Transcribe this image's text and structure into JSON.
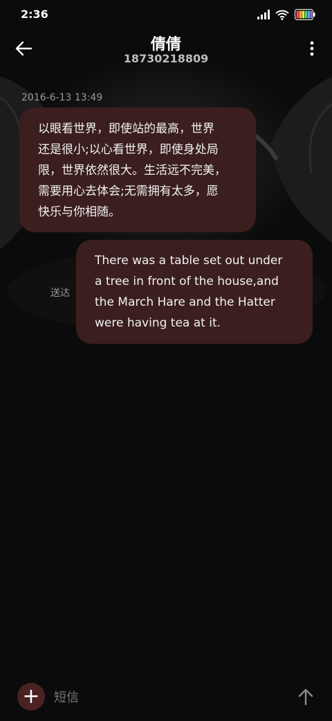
{
  "status_bar": {
    "time": "2:36",
    "icons": [
      "signal-icon",
      "wifi-icon",
      "battery-icon"
    ]
  },
  "header": {
    "contact_name": "倩倩",
    "contact_number": "18730218809",
    "back_icon": "back-arrow-icon",
    "menu_icon": "more-vertical-icon"
  },
  "conversation": {
    "timestamp": "2016-6-13 13:49",
    "messages": [
      {
        "direction": "incoming",
        "lines": [
          "以眼看世界，即使站的最高，世界",
          "还是很小;以心看世界，即使身处局",
          "限，世界依然很大。生活远不完美，",
          "需要用心去体会;无需拥有太多，愿",
          "快乐与你相随。"
        ]
      },
      {
        "direction": "outgoing",
        "lines": [
          "There was a table set out under",
          "a tree in front of the house,and",
          "the March Hare and the Hatter",
          "were having tea at it."
        ],
        "status": "送达"
      }
    ]
  },
  "composer": {
    "add_label": "+",
    "placeholder": "短信",
    "send_icon": "send-arrow-icon"
  },
  "colors": {
    "background": "#0a0a0a",
    "bubble": "#3b1e1e",
    "add_button": "#4a2222",
    "secondary_text": "#9a9a9a"
  }
}
